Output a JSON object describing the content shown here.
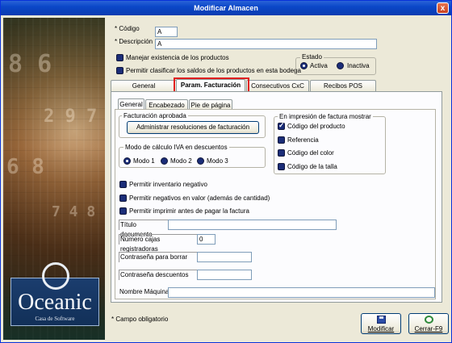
{
  "window": {
    "title": "Modificar Almacen",
    "close_glyph": "x"
  },
  "logo": {
    "name": "Oceanic",
    "subtitle": "Casa de Software"
  },
  "form": {
    "codigo_label": "* Código",
    "codigo_value": "A",
    "descripcion_label": "* Descripción",
    "descripcion_value": "A",
    "manejar_existencia": {
      "label": "Manejar existencia de los productos",
      "checked": false
    },
    "permitir_clasificar": {
      "label": "Permitir clasificar los saldos de los productos en esta bodega",
      "checked": false
    },
    "estado": {
      "legend": "Estado",
      "activa": "Activa",
      "inactiva": "Inactiva",
      "selected": "Activa"
    }
  },
  "tabs": [
    {
      "label": "General"
    },
    {
      "label": "Param. Facturación"
    },
    {
      "label": "Consecutivos CxC"
    },
    {
      "label": "Recibos POS"
    }
  ],
  "active_tab": "Param. Facturación",
  "subtabs": [
    {
      "label": "General"
    },
    {
      "label": "Encabezado"
    },
    {
      "label": "Pie de página"
    }
  ],
  "facturacion": {
    "group_label": "Facturación aprobada",
    "admin_button": "Administrar resoluciones de facturación",
    "iva_group": "Modo de cálculo IVA en descuentos",
    "modos": [
      "Modo 1",
      "Modo 2",
      "Modo 3"
    ],
    "impresion_group": "En impresión de factura mostrar",
    "impresion_items": [
      {
        "label": "Código del producto",
        "checked": true
      },
      {
        "label": "Referencia",
        "checked": false
      },
      {
        "label": "Código del color",
        "checked": false
      },
      {
        "label": "Código de la talla",
        "checked": false
      }
    ],
    "options": [
      {
        "label": "Permitir inventario negativo",
        "checked": false
      },
      {
        "label": "Permitir negativos en valor (además de cantidad)",
        "checked": false
      },
      {
        "label": "Permitir imprimir antes de pagar la factura",
        "checked": false
      }
    ],
    "titulo_documento": {
      "label": "Título documento",
      "value": ""
    },
    "numero_cajas": {
      "label": "Número cajas registradoras",
      "value": "0"
    },
    "pwd_borrar": {
      "label": "Contraseña para borrar",
      "value": ""
    },
    "pwd_descuentos": {
      "label": "Contraseña descuentos",
      "value": ""
    },
    "nombre_maquina": {
      "label": "Nombre Máquina",
      "value": ""
    }
  },
  "footer": {
    "note": "* Campo obligatorio",
    "modificar": "Modificar",
    "cerrar": "Cerrar-F9"
  }
}
